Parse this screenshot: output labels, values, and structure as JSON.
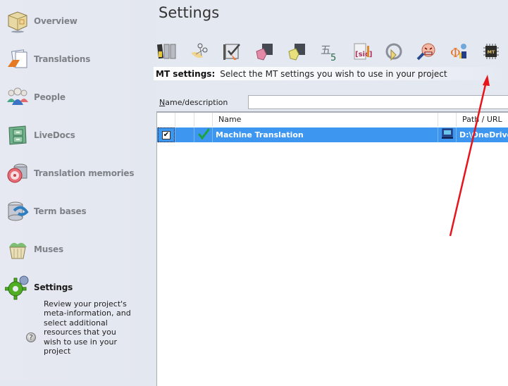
{
  "sidebar": {
    "items": [
      {
        "label": "Overview",
        "icon": "box-icon"
      },
      {
        "label": "Translations",
        "icon": "documents-icon"
      },
      {
        "label": "People",
        "icon": "people-icon"
      },
      {
        "label": "LiveDocs",
        "icon": "file-cabinet-icon"
      },
      {
        "label": "Translation memories",
        "icon": "database-disc-icon"
      },
      {
        "label": "Term bases",
        "icon": "database-arrow-icon"
      },
      {
        "label": "Muses",
        "icon": "basket-icon"
      },
      {
        "label": "Settings",
        "icon": "gear-icon",
        "active": true
      }
    ],
    "description": "Review your project's meta-information, and select additional resources that you wish to use in your project",
    "help_glyph": "?"
  },
  "main": {
    "title": "Settings",
    "toolbar": [
      {
        "name": "segmentation-rules-icon"
      },
      {
        "name": "cut-paste-icon"
      },
      {
        "name": "qa-settings-icon"
      },
      {
        "name": "pink-puzzle-icon"
      },
      {
        "name": "yellow-puzzle-icon"
      },
      {
        "name": "character-count-icon"
      },
      {
        "name": "sic-icon"
      },
      {
        "name": "refresh-circle-icon"
      },
      {
        "name": "angry-face-icon"
      },
      {
        "name": "phi-tools-icon"
      },
      {
        "name": "mt-chip-icon",
        "label": "MT",
        "selected": true
      }
    ],
    "section": {
      "title": "MT settings:",
      "description": "Select the MT settings you wish to use in your project"
    },
    "filter": {
      "label_accesskey": "N",
      "label_rest": "ame/description",
      "value": ""
    },
    "grid": {
      "columns": [
        "",
        "",
        "",
        "Name",
        "",
        "Path / URL"
      ],
      "rows": [
        {
          "checked": true,
          "check_glyph": "✔",
          "status_icon": "green-check-icon",
          "name": "Machine Translation",
          "location_icon": "computer-icon",
          "path": "D:\\OneDrive"
        }
      ]
    }
  },
  "annotation": {
    "color": "#e8141c"
  }
}
